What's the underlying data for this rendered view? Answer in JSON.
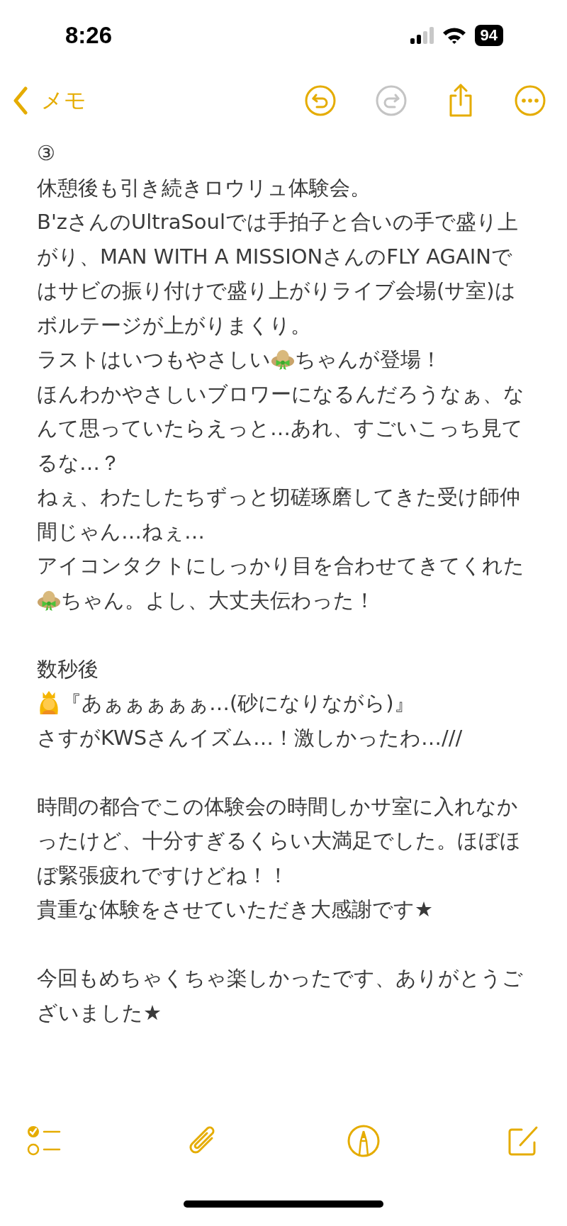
{
  "status_bar": {
    "time": "8:26",
    "battery": "94"
  },
  "nav": {
    "back_label": "メモ",
    "undo_disabled": false,
    "redo_disabled": true
  },
  "note": {
    "blocks": [
      [
        [
          {
            "kind": "text",
            "text": "③"
          }
        ],
        [
          {
            "kind": "text",
            "text": "休憩後も引き続きロウリュ体験会。"
          }
        ],
        [
          {
            "kind": "text",
            "text": "B'zさんのUltraSoulでは手拍子と合いの手で盛り上がり、MAN WITH A MISSIONさんのFLY AGAINではサビの振り付けで盛り上がりライブ会場(サ室)はボルテージが上がりまくり。"
          }
        ],
        [
          {
            "kind": "text",
            "text": "ラストはいつもやさしい"
          },
          {
            "kind": "hat"
          },
          {
            "kind": "text",
            "text": "ちゃんが登場！"
          }
        ],
        [
          {
            "kind": "text",
            "text": "ほんわかやさしいブロワーになるんだろうなぁ、なんて思っていたらえっと…あれ、すごいこっち見てるな…？"
          }
        ],
        [
          {
            "kind": "text",
            "text": "ねぇ、わたしたちずっと切磋琢磨してきた受け師仲間じゃん…ねぇ…"
          }
        ],
        [
          {
            "kind": "text",
            "text": "アイコンタクトにしっかり目を合わせてきてくれた"
          },
          {
            "kind": "hat"
          },
          {
            "kind": "text",
            "text": "ちゃん。よし、大丈夫伝わった！"
          }
        ]
      ],
      [
        [
          {
            "kind": "text",
            "text": "数秒後"
          }
        ],
        [
          {
            "kind": "crowned"
          },
          {
            "kind": "text",
            "text": "『あぁぁぁぁぁ…(砂になりながら)』"
          }
        ],
        [
          {
            "kind": "text",
            "text": "さすがKWSさんイズム…！激しかったわ…///"
          }
        ]
      ],
      [
        [
          {
            "kind": "text",
            "text": "時間の都合でこの体験会の時間しかサ室に入れなかったけど、十分すぎるくらい大満足でした。ほぼほぼ緊張疲れですけどね！！"
          }
        ],
        [
          {
            "kind": "text",
            "text": "貴重な体験をさせていただき大感謝です★"
          }
        ]
      ],
      [
        [
          {
            "kind": "text",
            "text": "今回もめちゃくちゃ楽しかったです、ありがとうございました★"
          }
        ]
      ]
    ]
  }
}
